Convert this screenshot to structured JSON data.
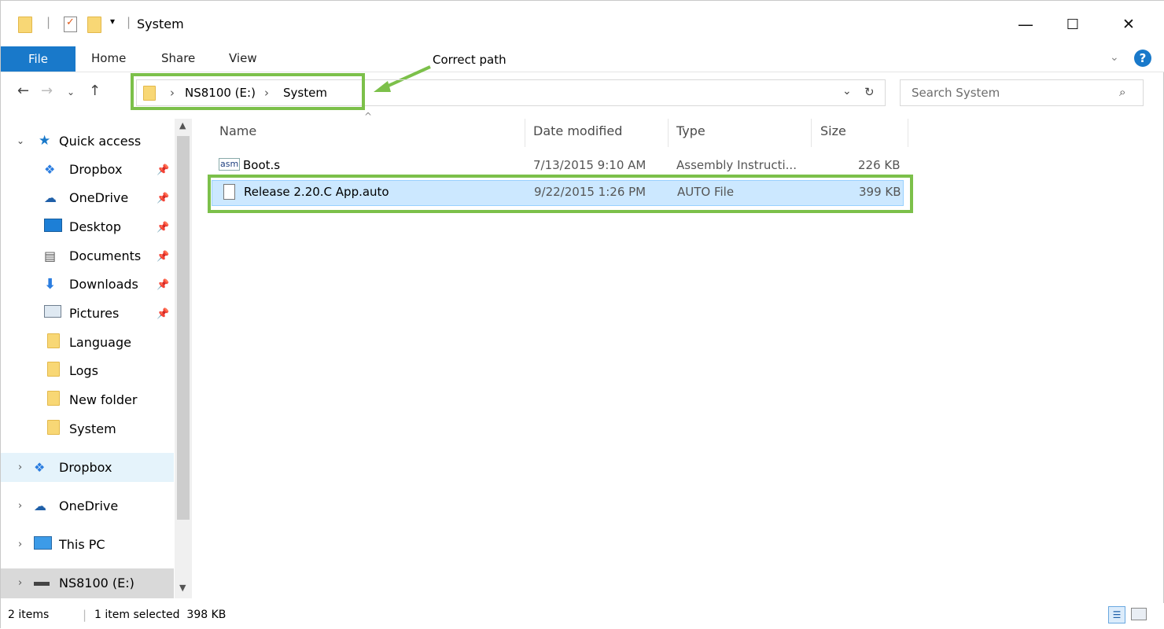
{
  "window": {
    "title": "System",
    "minimize_glyph": "—",
    "maximize_glyph": "☐",
    "close_glyph": "✕"
  },
  "ribbon": {
    "tabs": [
      "File",
      "Home",
      "Share",
      "View"
    ],
    "help_glyph": "?"
  },
  "address": {
    "segments": [
      "NS8100 (E:)",
      "System"
    ],
    "separator": "›"
  },
  "search": {
    "placeholder": "Search System"
  },
  "annotation": {
    "text": "Correct path",
    "color": "#7cc04a"
  },
  "sidebar": {
    "quick_access": "Quick access",
    "quick_items": [
      {
        "label": "Dropbox",
        "pinned": true,
        "icon": "dropbox-icon"
      },
      {
        "label": "OneDrive",
        "pinned": true,
        "icon": "onedrive-icon"
      },
      {
        "label": "Desktop",
        "pinned": true,
        "icon": "desktop-icon"
      },
      {
        "label": "Documents",
        "pinned": true,
        "icon": "documents-icon"
      },
      {
        "label": "Downloads",
        "pinned": true,
        "icon": "downloads-icon"
      },
      {
        "label": "Pictures",
        "pinned": true,
        "icon": "pictures-icon"
      },
      {
        "label": "Language",
        "pinned": false,
        "icon": "folder-icon"
      },
      {
        "label": "Logs",
        "pinned": false,
        "icon": "folder-icon"
      },
      {
        "label": "New folder",
        "pinned": false,
        "icon": "folder-icon"
      },
      {
        "label": "System",
        "pinned": false,
        "icon": "folder-icon"
      }
    ],
    "roots": [
      {
        "label": "Dropbox",
        "icon": "dropbox-icon"
      },
      {
        "label": "OneDrive",
        "icon": "onedrive-icon"
      },
      {
        "label": "This PC",
        "icon": "computer-icon"
      },
      {
        "label": "NS8100 (E:)",
        "icon": "drive-icon"
      }
    ]
  },
  "columns": {
    "name": "Name",
    "date": "Date modified",
    "type": "Type",
    "size": "Size"
  },
  "files": [
    {
      "icon_label": "asm",
      "name": "Boot.s",
      "date": "7/13/2015 9:10 AM",
      "type": "Assembly Instructi...",
      "size": "226 KB",
      "selected": false
    },
    {
      "icon_label": "",
      "name": "Release 2.20.C App.auto",
      "date": "9/22/2015 1:26 PM",
      "type": "AUTO File",
      "size": "399 KB",
      "selected": true
    }
  ],
  "status": {
    "items": "2 items",
    "selection": "1 item selected  398 KB"
  },
  "colors": {
    "accent": "#1979ca",
    "selection": "#cce8ff",
    "highlight": "#7cc04a"
  }
}
